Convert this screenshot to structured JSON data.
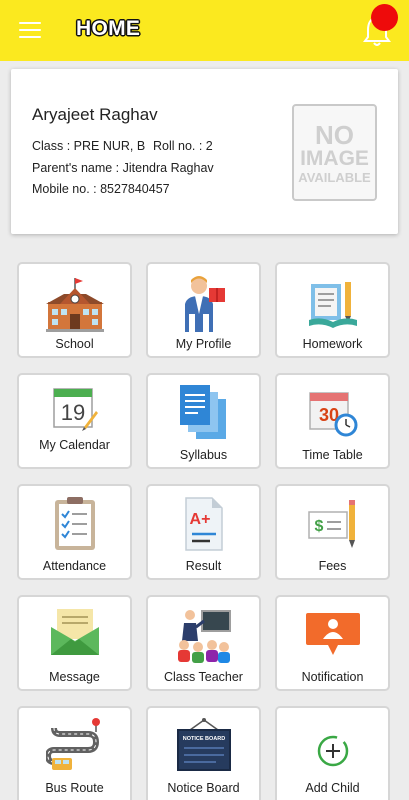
{
  "app_bar": {
    "title": "HOME",
    "menu_icon": "hamburger-menu-icon",
    "notification_icon": "bell-icon",
    "badge_color": "#ee0b0b",
    "bar_color": "#fbe91f"
  },
  "profile": {
    "name": "Aryajeet Raghav",
    "class_line": "Class : PRE NUR, B",
    "roll_line": "Roll no. : 2",
    "parent_line": "Parent's name : Jitendra Raghav",
    "mobile_line": "Mobile no. : 8527840457",
    "photo_placeholder": {
      "line1": "NO",
      "line2": "IMAGE",
      "line3": "AVAILABLE"
    }
  },
  "menu": {
    "tiles": [
      {
        "label": "School",
        "icon": "school-icon"
      },
      {
        "label": "My Profile",
        "icon": "profile-icon"
      },
      {
        "label": "Homework",
        "icon": "homework-icon"
      },
      {
        "label": "My Calendar",
        "icon": "calendar-icon",
        "icon_text": "19"
      },
      {
        "label": "Syllabus",
        "icon": "syllabus-icon"
      },
      {
        "label": "Time Table",
        "icon": "timetable-icon",
        "icon_text": "30"
      },
      {
        "label": "Attendance",
        "icon": "attendance-icon"
      },
      {
        "label": "Result",
        "icon": "result-icon",
        "icon_text": "A+"
      },
      {
        "label": "Fees",
        "icon": "fees-icon"
      },
      {
        "label": "Message",
        "icon": "message-icon"
      },
      {
        "label": "Class Teacher",
        "icon": "class-teacher-icon"
      },
      {
        "label": "Notification",
        "icon": "notification-icon"
      },
      {
        "label": "Bus Route",
        "icon": "bus-route-icon"
      },
      {
        "label": "Notice Board",
        "icon": "notice-board-icon",
        "icon_text": "NOTICE BOARD"
      },
      {
        "label": "Add Child",
        "icon": "add-child-icon"
      }
    ]
  }
}
